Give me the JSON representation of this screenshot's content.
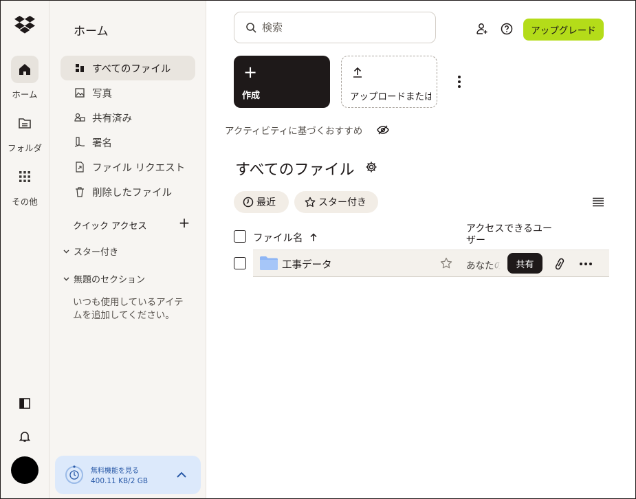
{
  "rail": {
    "items": [
      {
        "label": "ホーム",
        "icon": "home-icon"
      },
      {
        "label": "フォルダ",
        "icon": "folder-icon"
      },
      {
        "label": "その他",
        "icon": "grid-icon"
      }
    ]
  },
  "sidebar": {
    "title": "ホーム",
    "items": [
      {
        "label": "すべてのファイル",
        "icon": "files-icon"
      },
      {
        "label": "写真",
        "icon": "image-icon"
      },
      {
        "label": "共有済み",
        "icon": "shared-icon"
      },
      {
        "label": "署名",
        "icon": "signature-icon"
      },
      {
        "label": "ファイル リクエスト",
        "icon": "file-request-icon"
      },
      {
        "label": "削除したファイル",
        "icon": "trash-icon"
      }
    ],
    "quick_access": {
      "title": "クイック アクセス",
      "sections": [
        "スター付き",
        "無題のセクション"
      ],
      "empty_text": "いつも使用しているアイテムを追加してください。"
    },
    "storage": {
      "label": "無料機能を見る",
      "usage": "400.11 KB/2 GB"
    }
  },
  "header": {
    "search_placeholder": "検索",
    "upgrade_label": "アップグレード"
  },
  "actions": {
    "create_label": "作成",
    "upload_label": "アップロードまたはドロップ"
  },
  "suggestions_label": "アクティビティに基づくおすすめ",
  "page_title": "すべてのファイル",
  "filters": [
    {
      "label": "最近",
      "icon": "clock-icon"
    },
    {
      "label": "スター付き",
      "icon": "star-icon"
    }
  ],
  "table": {
    "columns": {
      "name": "ファイル名",
      "access": "アクセスできるユーザー"
    },
    "rows": [
      {
        "name": "工事データ",
        "type": "folder",
        "access": "あなたのみ",
        "share_label": "共有"
      }
    ]
  },
  "colors": {
    "accent_upgrade": "#b4dc19",
    "primary_dark": "#1e1919",
    "sidebar_bg": "#f7f5f2",
    "folder": "#8fb6f5"
  }
}
